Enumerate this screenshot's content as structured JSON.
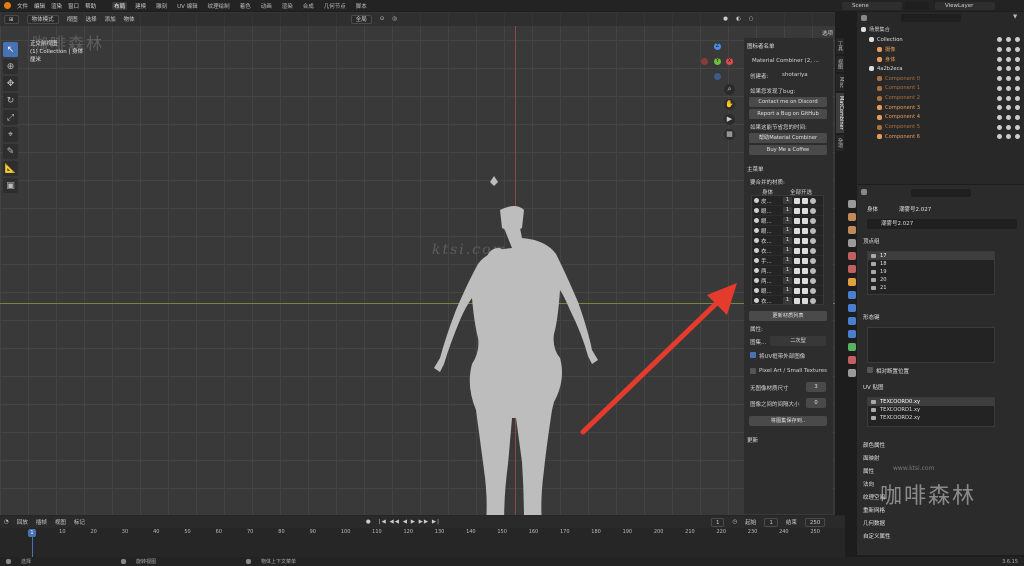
{
  "menu": {
    "items": [
      "文件",
      "编辑",
      "渲染",
      "窗口",
      "帮助"
    ],
    "workspaces": [
      "布局",
      "建模",
      "雕刻",
      "UV 编辑",
      "纹理绘制",
      "着色",
      "动画",
      "渲染",
      "合成",
      "几何节点",
      "脚本"
    ],
    "active_workspace": "布局",
    "scene": "Scene",
    "view_layer": "ViewLayer"
  },
  "viewport_header": {
    "mode": "物体模式",
    "menus": [
      "视图",
      "选择",
      "添加",
      "物体"
    ],
    "transform": "全局",
    "options": "选项"
  },
  "viewport_info": {
    "line1": "正交前视图",
    "line2": "(1) Collection | 身体",
    "line3": "厘米"
  },
  "watermarks": {
    "top": "咖啡森林",
    "center": "ktsi.com",
    "bottom": "咖啡森林",
    "url": "www.ktsi.com"
  },
  "npanel": {
    "title": "图标者名单",
    "addon_name": "Material Combiner (2, ...",
    "creator_label": "创建者:",
    "creator": "shotariya",
    "bug_label": "如果您发现了bug:",
    "discord_btn": "Contact me on Discord",
    "github_btn": "Report a Bug on GitHub",
    "support_label": "如果这能节省您的时间:",
    "patreon_btn": "帮助Material Combiner",
    "coffee_btn": "Buy Me a Coffee",
    "main_menu": "主菜单",
    "mat_header": "要合并的材质:",
    "col_body": "身体",
    "col_all": "全部开选",
    "materials": [
      {
        "name": "皮...",
        "num": "1"
      },
      {
        "name": "眼...",
        "num": "1"
      },
      {
        "name": "眼...",
        "num": "1"
      },
      {
        "name": "眼...",
        "num": "1"
      },
      {
        "name": "衣...",
        "num": "1"
      },
      {
        "name": "衣...",
        "num": "1"
      },
      {
        "name": "手...",
        "num": "1"
      },
      {
        "name": "两...",
        "num": "1"
      },
      {
        "name": "两...",
        "num": "1"
      },
      {
        "name": "眼...",
        "num": "1"
      },
      {
        "name": "衣...",
        "num": "1"
      }
    ],
    "update_btn": "更新材质列表",
    "props_label": "属性:",
    "atlas_label": "图集...",
    "atlas_value": "二次型",
    "uv_check": "将UV框带外部图像",
    "pixel_check": "Pixel Art / Small Textures",
    "size_label": "无图像材质尺寸",
    "size_value": "3",
    "gap_label": "图像之间的间隔大小",
    "gap_value": "0",
    "save_btn": "将图集保存到..",
    "update_section": "更新",
    "tabs": [
      "工具",
      "视图",
      "Misc",
      "MatCombiner",
      "杂项"
    ]
  },
  "outliner": {
    "title": "场景集合",
    "rows": [
      {
        "name": "Collection",
        "indent": 1,
        "color": "#ddd"
      },
      {
        "name": "摄像",
        "indent": 2,
        "color": "#e89b5a"
      },
      {
        "name": "身体",
        "indent": 2,
        "color": "#e89b5a"
      },
      {
        "name": "4a2b2eca",
        "indent": 1,
        "color": "#ddd"
      },
      {
        "name": "Component 0",
        "indent": 2,
        "color": "#a8703e"
      },
      {
        "name": "Component 1",
        "indent": 2,
        "color": "#a8703e"
      },
      {
        "name": "Component 2",
        "indent": 2,
        "color": "#a8703e"
      },
      {
        "name": "Component 3",
        "indent": 2,
        "color": "#e89b5a"
      },
      {
        "name": "Component 4",
        "indent": 2,
        "color": "#e89b5a"
      },
      {
        "name": "Component 5",
        "indent": 2,
        "color": "#a8703e"
      },
      {
        "name": "Component 6",
        "indent": 2,
        "color": "#e89b5a"
      }
    ]
  },
  "properties": {
    "breadcrumb_obj": "身体",
    "breadcrumb_mesh": "潮雾号2.027",
    "mesh_name": "潮雾号2.027",
    "vgroups_title": "顶点组",
    "vgroups": [
      "17",
      "18",
      "19",
      "20",
      "21"
    ],
    "shapekeys_title": "形态键",
    "relative_check": "相对断置位置",
    "uv_title": "UV 贴图",
    "uvmaps": [
      "TEXCOORD0.xy",
      "TEXCOORD1.xy",
      "TEXCOORD2.xy"
    ],
    "more_sections": [
      "颜色属性",
      "面映射",
      "属性",
      "法向",
      "纹理空间",
      "重新网格",
      "几何数据",
      "自定义属性"
    ]
  },
  "timeline": {
    "menus": [
      "回放",
      "插帧",
      "视图",
      "标记"
    ],
    "current_frame": "1",
    "start_label": "起始",
    "start": "1",
    "end_label": "结束",
    "end": "250",
    "ticks": [
      "1",
      "10",
      "20",
      "30",
      "40",
      "50",
      "60",
      "70",
      "80",
      "90",
      "100",
      "110",
      "120",
      "130",
      "140",
      "150",
      "160",
      "170",
      "180",
      "190",
      "200",
      "210",
      "220",
      "230",
      "240",
      "250"
    ]
  },
  "status": {
    "select": "选择",
    "rotate": "旋转视图",
    "context": "物体上下文菜单",
    "version": "3.6.15"
  },
  "colors": {
    "accent": "#4772b3",
    "annotation_arrow": "#e53b2c"
  }
}
